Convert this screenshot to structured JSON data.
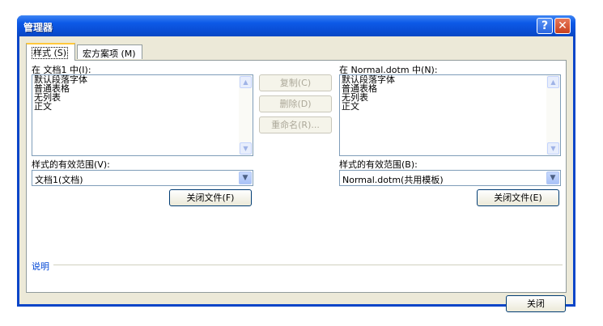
{
  "window": {
    "title": "管理器"
  },
  "titlebar_buttons": {
    "help": "?",
    "close": "✕"
  },
  "tabs": [
    {
      "label": "样式",
      "accel": "(S)"
    },
    {
      "label": "宏方案项",
      "accel": "(M)"
    }
  ],
  "left": {
    "header": "在 文档1 中(I):",
    "items": [
      "默认段落字体",
      "普通表格",
      "无列表",
      "正文"
    ],
    "scope_label": "样式的有效范围(V):",
    "scope_value": "文档1(文档)",
    "close_file": "关闭文件(F)"
  },
  "right": {
    "header": "在 Normal.dotm 中(N):",
    "items": [
      "默认段落字体",
      "普通表格",
      "无列表",
      "正文"
    ],
    "scope_label": "样式的有效范围(B):",
    "scope_value": "Normal.dotm(共用模板)",
    "close_file": "关闭文件(E)"
  },
  "middle_buttons": {
    "copy": "复制(C)",
    "delete": "删除(D)",
    "rename": "重命名(R)..."
  },
  "description_label": "说明",
  "close_button": "关闭",
  "icons": {
    "scroll_up": "▲",
    "scroll_down": "▼",
    "dropdown": "▼"
  }
}
